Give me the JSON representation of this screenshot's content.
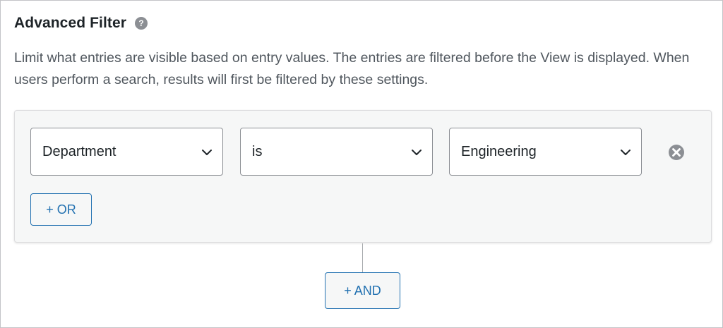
{
  "header": {
    "title": "Advanced Filter",
    "help_icon": "question-mark-icon",
    "help_glyph": "?"
  },
  "description": "Limit what entries are visible based on entry values. The entries are filtered before the View is displayed. When users perform a search, results will first be filtered by these settings.",
  "filter": {
    "condition": {
      "field": "Department",
      "operator": "is",
      "value": "Engineering"
    },
    "remove_icon": "circle-x-icon",
    "or_label": "+ OR"
  },
  "and_label": "+ AND",
  "colors": {
    "accent": "#2271b1",
    "box_bg": "#f6f7f7",
    "icon_gray": "#8c8f94"
  }
}
